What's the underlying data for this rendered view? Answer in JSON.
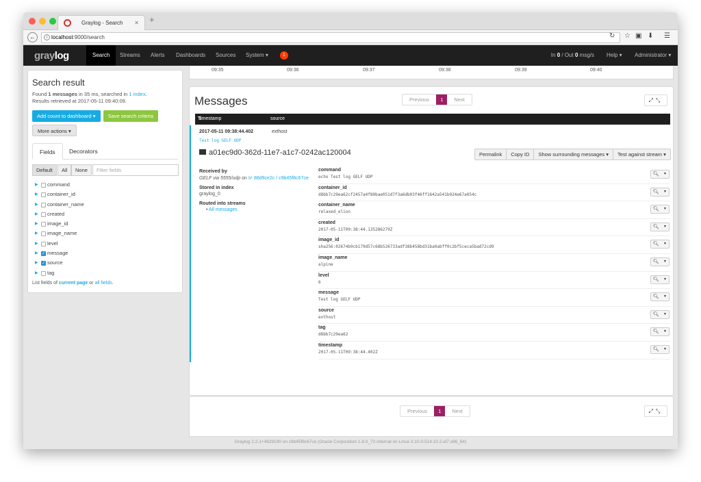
{
  "browser": {
    "tab_title": "Graylog - Search",
    "url_host": "localhost",
    "url_rest": ":9000/search"
  },
  "navbar": {
    "logo_gray": "gray",
    "logo_log": "log",
    "items": [
      "Search",
      "Streams",
      "Alerts",
      "Dashboards",
      "Sources",
      "System ▾"
    ],
    "notification_count": "1",
    "throughput_in_label": "In",
    "throughput_in": "0",
    "throughput_mid": "/ Out",
    "throughput_out": "0",
    "throughput_unit": "msg/s",
    "help": "Help ▾",
    "user": "Administrator ▾"
  },
  "search_result": {
    "title": "Search result",
    "found_prefix": "Found",
    "found_count": "1 messages",
    "found_mid": "in 35 ms, searched in",
    "found_link": "1 index",
    "found_end": ".",
    "retrieved": "Results retrieved at 2017-05-11 09:40:09.",
    "add_dashboard": "Add count to dashboard ▾",
    "save_criteria": "Save search criteria",
    "more_actions": "More actions ▾"
  },
  "field_tabs": {
    "fields": "Fields",
    "decorators": "Decorators"
  },
  "field_filter": {
    "default": "Default",
    "all": "All",
    "none": "None",
    "placeholder": "Filter fields"
  },
  "fields": [
    {
      "name": "command",
      "checked": false
    },
    {
      "name": "container_id",
      "checked": false
    },
    {
      "name": "container_name",
      "checked": false
    },
    {
      "name": "created",
      "checked": false
    },
    {
      "name": "image_id",
      "checked": false
    },
    {
      "name": "image_name",
      "checked": false
    },
    {
      "name": "level",
      "checked": false
    },
    {
      "name": "message",
      "checked": true
    },
    {
      "name": "source",
      "checked": true
    },
    {
      "name": "tag",
      "checked": false
    }
  ],
  "field_note": {
    "prefix": "List fields of",
    "current": "current page",
    "mid": "or",
    "all": "all fields",
    "end": "."
  },
  "histogram_times": [
    "09:35",
    "09:36",
    "09:37",
    "09:38",
    "09:39",
    "09:40"
  ],
  "messages": {
    "title": "Messages",
    "pager": {
      "prev": "Previous",
      "page": "1",
      "next": "Next"
    },
    "col_timestamp": "Timestamp",
    "col_source": "source",
    "row": {
      "timestamp": "2017-05-11 09:38:44.402",
      "source": "exthost",
      "message": "Test log GELF UDP",
      "id": "a01ec9d0-362d-11e7-a1c7-0242ac120004"
    },
    "actions": [
      "Permalink",
      "Copy ID",
      "Show surrounding messages ▾",
      "Test against stream ▾"
    ],
    "meta": {
      "received_label": "Received by",
      "received_input": "GELF via 5555/udp",
      "received_on": "on",
      "received_node": "⊮ 88d9ce2c / c9b45f8c67ce",
      "stored_label": "Stored in index",
      "stored_value": "graylog_0",
      "routed_label": "Routed into streams",
      "routed_value": "All messages"
    },
    "fields": [
      {
        "name": "command",
        "value": "echo Test log GELF UDP"
      },
      {
        "name": "container_id",
        "value": "d8bb7c29ea62cf2457a4f80bae051d7f3a6db03f46ff1642a541b024e67a054c"
      },
      {
        "name": "container_name",
        "value": "relaxed_elion"
      },
      {
        "name": "created",
        "value": "2017-05-11T09:38:44.135286279Z"
      },
      {
        "name": "image_id",
        "value": "sha256:02674b9cb179d57c68b526733adf38b458bd31ba0abff0c2bf5ceca5bad72cd9"
      },
      {
        "name": "image_name",
        "value": "alpine"
      },
      {
        "name": "level",
        "value": "6"
      },
      {
        "name": "message",
        "value": "Test log GELF UDP"
      },
      {
        "name": "source",
        "value": "exthost"
      },
      {
        "name": "tag",
        "value": "d8bb7c29ea62"
      },
      {
        "name": "timestamp",
        "value": "2017-05-11T09:38:44.402Z"
      }
    ]
  },
  "footer": "Graylog 2.2.1+4829190 on c9b45f8c67ce (Oracle Corporation 1.8.0_72-internal on Linux 3.10.0-514.10.2.el7.x86_64)",
  "colors": {
    "accent": "#16ace3",
    "green": "#8dc63f",
    "page": "#9e1f63",
    "navbar": "#1f1f1f",
    "badge": "#ff3b00"
  }
}
